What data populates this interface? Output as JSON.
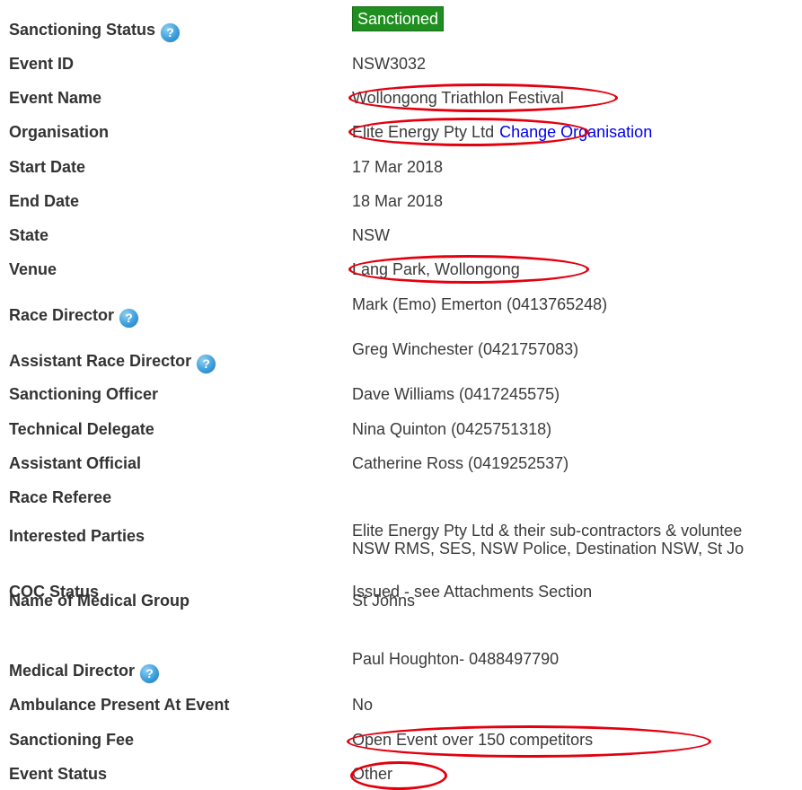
{
  "rows": [
    {
      "label": "Sanctioning Status",
      "value": "Sanctioned"
    },
    {
      "label": "Event ID",
      "value": "NSW3032"
    },
    {
      "label": "Event Name",
      "value": "Wollongong Triathlon Festival"
    },
    {
      "label": "Organisation",
      "value": "Elite Energy Pty Ltd",
      "link": "Change Organisation"
    },
    {
      "label": "Start Date",
      "value": "17 Mar 2018"
    },
    {
      "label": "End Date",
      "value": "18 Mar 2018"
    },
    {
      "label": "State",
      "value": "NSW"
    },
    {
      "label": "Venue",
      "value": "Lang Park, Wollongong"
    },
    {
      "label": "Race Director",
      "value": "Mark (Emo) Emerton (0413765248)"
    },
    {
      "label": "Assistant Race Director",
      "value": "Greg Winchester (0421757083)"
    },
    {
      "label": "Sanctioning Officer",
      "value": "Dave Williams (0417245575)"
    },
    {
      "label": "Technical Delegate",
      "value": "Nina Quinton (0425751318)"
    },
    {
      "label": "Assistant Official",
      "value": "Catherine Ross (0419252537)"
    },
    {
      "label": "Race Referee",
      "value": ""
    },
    {
      "label": "Interested Parties",
      "value_line1": "Elite Energy Pty Ltd & their sub-contractors & voluntee",
      "value_line2": "NSW RMS, SES, NSW Police, Destination NSW, St Jo"
    },
    {
      "label": "COC Status",
      "value": "Issued - see Attachments Section"
    },
    {
      "label": "Name of Medical Group",
      "value": "St Johns"
    },
    {
      "label": "Medical Director",
      "value": "Paul Houghton- 0488497790"
    },
    {
      "label": "Ambulance Present At Event",
      "value": "No"
    },
    {
      "label": "Sanctioning Fee",
      "value": "Open Event over 150 competitors"
    },
    {
      "label": "Event Status",
      "value": "Other"
    }
  ],
  "help_icon_glyph": "?",
  "colors": {
    "badge": "#1f8f1f",
    "link": "#0000ee",
    "annotation": "#e3000f"
  }
}
